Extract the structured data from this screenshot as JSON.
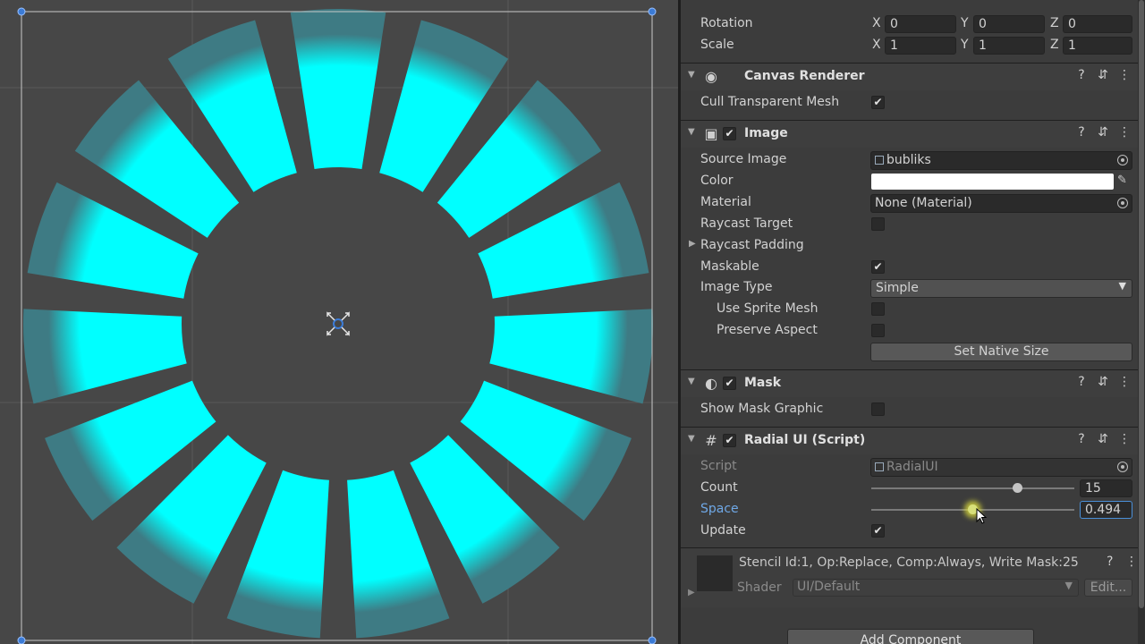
{
  "transform": {
    "rotation": {
      "label": "Rotation",
      "x": "0",
      "y": "0",
      "z": "0"
    },
    "scale": {
      "label": "Scale",
      "x": "1",
      "y": "1",
      "z": "1"
    },
    "axis_x": "X",
    "axis_y": "Y",
    "axis_z": "Z"
  },
  "canvas_renderer": {
    "title": "Canvas Renderer",
    "cull_label": "Cull Transparent Mesh",
    "cull_checked": true
  },
  "image": {
    "title": "Image",
    "source_label": "Source Image",
    "source_value": "bubliks",
    "color_label": "Color",
    "color_value": "#ffffff",
    "material_label": "Material",
    "material_value": "None (Material)",
    "raycast_target_label": "Raycast Target",
    "raycast_padding_label": "Raycast Padding",
    "maskable_label": "Maskable",
    "image_type_label": "Image Type",
    "image_type_value": "Simple",
    "use_sprite_mesh_label": "Use Sprite Mesh",
    "preserve_aspect_label": "Preserve Aspect",
    "set_native_size_label": "Set Native Size"
  },
  "mask": {
    "title": "Mask",
    "show_graphic_label": "Show Mask Graphic"
  },
  "radial": {
    "title": "Radial UI (Script)",
    "script_label": "Script",
    "script_value": "RadialUI",
    "count_label": "Count",
    "count_value": "15",
    "count_fraction": 0.72,
    "space_label": "Space",
    "space_value": "0.494",
    "space_fraction": 0.5,
    "update_label": "Update"
  },
  "material_footer": {
    "info": "Stencil Id:1, Op:Replace, Comp:Always, Write Mask:25",
    "shader_label": "Shader",
    "shader_value": "UI/Default",
    "edit_label": "Edit..."
  },
  "add_component_label": "Add Component",
  "header_icons": {
    "help": "?",
    "preset": "⇵",
    "menu": "⋮"
  },
  "scene": {
    "segment_count": 15,
    "accent_color": "#00ffff",
    "fade_color": "#3e7b84",
    "background_color": "#474747"
  }
}
